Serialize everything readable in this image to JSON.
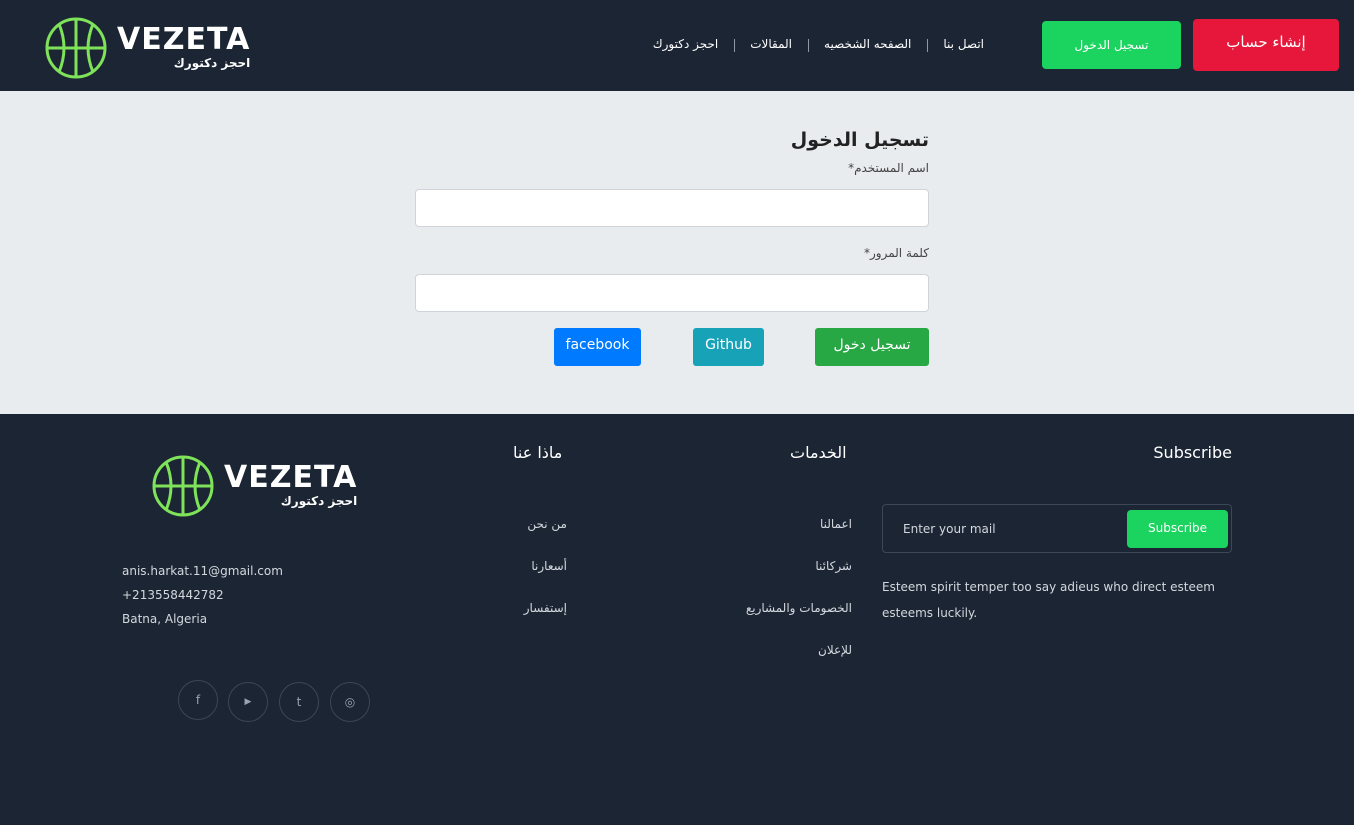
{
  "header": {
    "logo": {
      "brand": "VEZETA",
      "tagline": "احجز دكتورك"
    },
    "nav": [
      {
        "label": "اتصل بنا"
      },
      {
        "label": "الصفحه الشخصيه"
      },
      {
        "label": "المقالات"
      },
      {
        "label": "احجز دكتورك"
      }
    ],
    "login_label": "تسجيل الدخول",
    "register_label": "إنشاء حساب"
  },
  "login_form": {
    "title": "تسجيل الدخول",
    "username_label": "اسم المستخدم*",
    "username_value": "",
    "password_label": "كلمة المرور*",
    "password_value": "",
    "submit_label": "تسجيل دخول",
    "github_label": "Github",
    "facebook_label": "facebook"
  },
  "footer": {
    "logo": {
      "brand": "VEZETA",
      "tagline": "احجز دكتورك"
    },
    "contact": {
      "email": "anis.harkat.11@gmail.com",
      "phone": "+213558442782",
      "address": "Batna, Algeria"
    },
    "socials": [
      {
        "icon": "facebook-icon",
        "glyph": "f"
      },
      {
        "icon": "youtube-icon",
        "glyph": "▶"
      },
      {
        "icon": "twitter-icon",
        "glyph": "t"
      },
      {
        "icon": "instagram-icon",
        "glyph": "◎"
      }
    ],
    "about": {
      "title": "ماذا عنا",
      "links": [
        "من نحن",
        "أسعارنا",
        "إستفسار"
      ]
    },
    "services": {
      "title": "الخدمات",
      "links": [
        "اعمالنا",
        "شركائنا",
        "الخصومات والمشاريع",
        "للإعلان"
      ]
    },
    "subscribe": {
      "title": "Subscribe",
      "placeholder": "Enter your mail",
      "button_label": "Subscribe",
      "text": "Esteem spirit temper too say adieus who direct esteem esteems luckily."
    }
  },
  "colors": {
    "dark_bg": "#1b2533",
    "accent_green": "#1bd35f",
    "accent_red": "#e6173a",
    "light_bg": "#e9ecef",
    "github_teal": "#17a2b8",
    "facebook_blue": "#007bff",
    "submit_green": "#28a745"
  }
}
